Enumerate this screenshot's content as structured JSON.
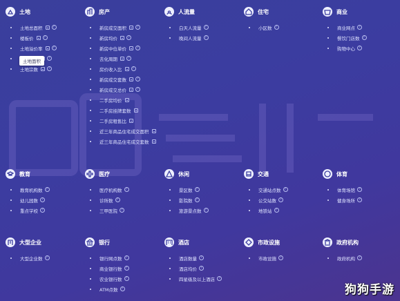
{
  "sections": [
    {
      "id": "land",
      "icon": "land-icon",
      "title": "土地",
      "items": [
        {
          "label": "土地总面积",
          "tag": true,
          "help": true
        },
        {
          "label": "楼板价",
          "tag": true,
          "help": true
        },
        {
          "label": "土地溢价率",
          "tag": true,
          "help": true
        },
        {
          "label": "土地面积",
          "tag": true,
          "help": true
        },
        {
          "label": "土地宗数",
          "tag": true,
          "help": true
        }
      ]
    },
    {
      "id": "property",
      "icon": "building-icon",
      "title": "房产",
      "items": [
        {
          "label": "新房成交面积",
          "tag": true,
          "help": true
        },
        {
          "label": "新房均价",
          "tag": true,
          "help": true
        },
        {
          "label": "新房中位单价",
          "tag": true,
          "help": true
        },
        {
          "label": "去化周期",
          "tag": true,
          "help": true
        },
        {
          "label": "房价收入比",
          "tag": true,
          "help": true
        },
        {
          "label": "新房成交套数",
          "tag": true,
          "help": true
        },
        {
          "label": "新房成交总价",
          "tag": true,
          "help": true
        },
        {
          "label": "二手房均价",
          "tag": true,
          "help": false
        },
        {
          "label": "二手房挂牌套数",
          "tag": true,
          "help": false
        },
        {
          "label": "二手房租售比",
          "tag": true,
          "help": false
        },
        {
          "label": "近三年商品住宅成交面积",
          "tag": true,
          "help": false
        },
        {
          "label": "近三年商品住宅成交套数",
          "tag": true,
          "help": false
        }
      ]
    },
    {
      "id": "population",
      "icon": "people-icon",
      "title": "人流量",
      "items": [
        {
          "label": "白天人流量",
          "tag": false,
          "help": true
        },
        {
          "label": "晚间人流量",
          "tag": false,
          "help": true
        }
      ]
    },
    {
      "id": "residential",
      "icon": "residential-icon",
      "title": "住宅",
      "items": [
        {
          "label": "小区数",
          "tag": false,
          "help": true
        }
      ]
    },
    {
      "id": "commerce",
      "icon": "shop-icon",
      "title": "商业",
      "items": [
        {
          "label": "商业网点",
          "tag": false,
          "help": true
        },
        {
          "label": "餐饮门店数",
          "tag": false,
          "help": true
        },
        {
          "label": "购物中心",
          "tag": false,
          "help": true
        }
      ]
    },
    {
      "id": "education",
      "icon": "education-icon",
      "title": "教育",
      "items": [
        {
          "label": "教育机构数",
          "tag": false,
          "help": true
        },
        {
          "label": "幼儿园数",
          "tag": false,
          "help": true
        },
        {
          "label": "重点学校",
          "tag": false,
          "help": true
        }
      ]
    },
    {
      "id": "medical",
      "icon": "medical-icon",
      "title": "医疗",
      "items": [
        {
          "label": "医疗机构数",
          "tag": false,
          "help": true
        },
        {
          "label": "诊所数",
          "tag": false,
          "help": true
        },
        {
          "label": "三甲医院",
          "tag": false,
          "help": true
        }
      ]
    },
    {
      "id": "leisure",
      "icon": "leisure-icon",
      "title": "休闲",
      "items": [
        {
          "label": "景区数",
          "tag": false,
          "help": true
        },
        {
          "label": "影院数",
          "tag": false,
          "help": true
        },
        {
          "label": "旅游景点数",
          "tag": false,
          "help": true
        }
      ]
    },
    {
      "id": "transport",
      "icon": "bus-icon",
      "title": "交通",
      "items": [
        {
          "label": "交通站点数",
          "tag": false,
          "help": true
        },
        {
          "label": "公交站数",
          "tag": false,
          "help": true
        },
        {
          "label": "地铁站",
          "tag": false,
          "help": true
        }
      ]
    },
    {
      "id": "sports",
      "icon": "sports-icon",
      "title": "体育",
      "items": [
        {
          "label": "体育场馆",
          "tag": false,
          "help": true
        },
        {
          "label": "健身场所",
          "tag": false,
          "help": true
        }
      ]
    },
    {
      "id": "enterprise",
      "icon": "enterprise-icon",
      "title": "大型企业",
      "items": [
        {
          "label": "大型企业数",
          "tag": false,
          "help": true
        }
      ]
    },
    {
      "id": "bank",
      "icon": "bank-icon",
      "title": "银行",
      "items": [
        {
          "label": "银行网点数",
          "tag": false,
          "help": true
        },
        {
          "label": "商业银行数",
          "tag": false,
          "help": true
        },
        {
          "label": "农业银行数",
          "tag": false,
          "help": true
        },
        {
          "label": "ATM点数",
          "tag": false,
          "help": true
        }
      ]
    },
    {
      "id": "hotel",
      "icon": "hotel-icon",
      "title": "酒店",
      "items": [
        {
          "label": "酒店数量",
          "tag": false,
          "help": true
        },
        {
          "label": "酒店均价",
          "tag": false,
          "help": true
        },
        {
          "label": "四星级及以上酒店",
          "tag": false,
          "help": true
        }
      ]
    },
    {
      "id": "municipal",
      "icon": "municipal-icon",
      "title": "市政设施",
      "items": [
        {
          "label": "市政设施",
          "tag": false,
          "help": true
        }
      ]
    },
    {
      "id": "government",
      "icon": "government-icon",
      "title": "政府机构",
      "items": [
        {
          "label": "政府机构",
          "tag": false,
          "help": true
        }
      ]
    }
  ],
  "tooltip": {
    "text": "土地面积"
  },
  "watermark": {
    "text": "狗狗手游"
  }
}
